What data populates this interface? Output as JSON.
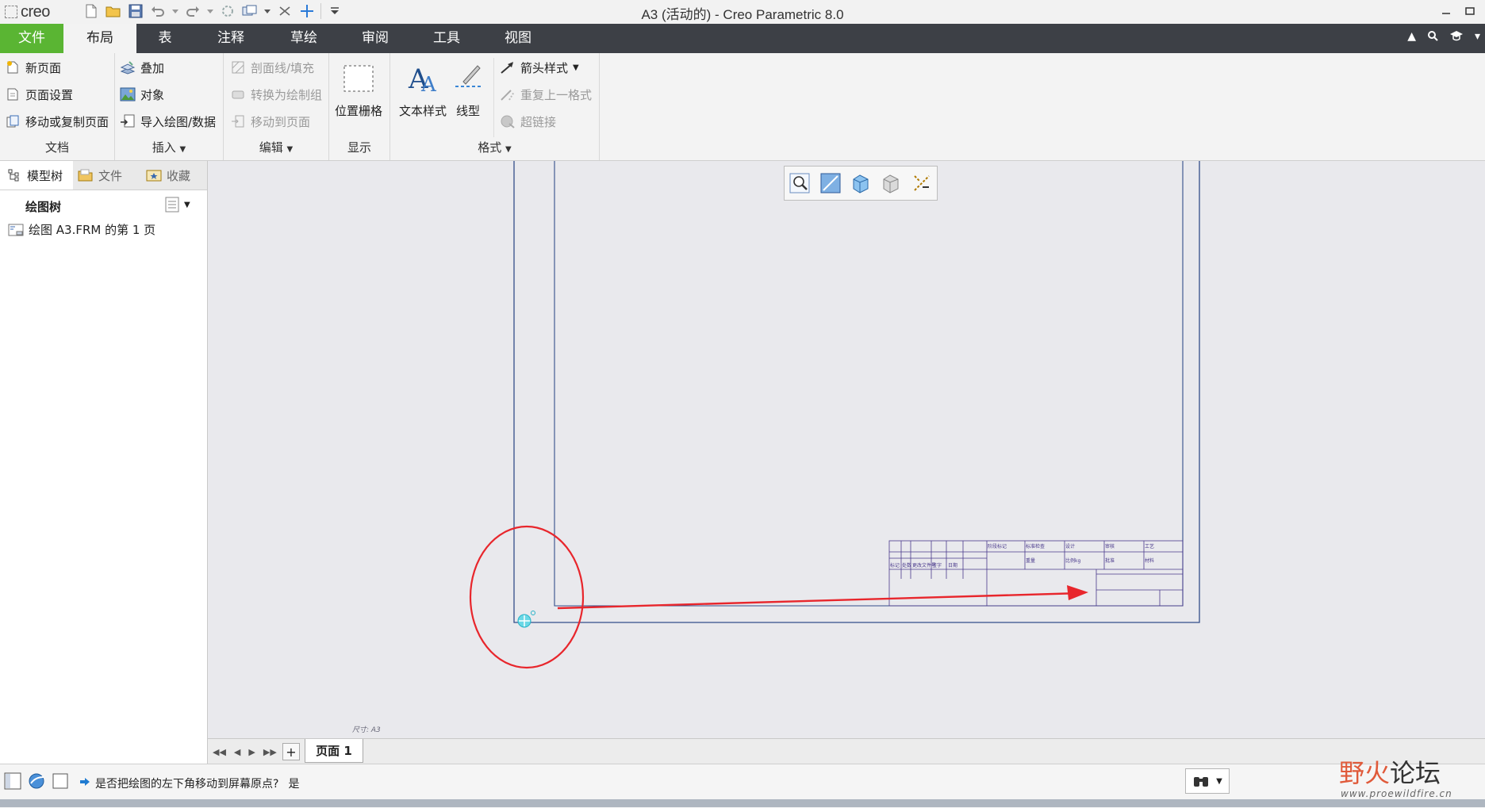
{
  "app": {
    "logo": "creo",
    "window_title": "A3 (活动的) - Creo Parametric 8.0"
  },
  "quick_access": [
    "new-icon",
    "open-icon",
    "save-icon",
    "undo-icon",
    "redo-icon",
    "regenerate-icon",
    "windows-icon",
    "close-window-icon",
    "datum-icon",
    "customize-icon"
  ],
  "tabs": {
    "file": "文件",
    "items": [
      "布局",
      "表",
      "注释",
      "草绘",
      "审阅",
      "工具",
      "视图"
    ],
    "active": "布局"
  },
  "ribbon": {
    "document": {
      "label": "文档",
      "new_page": "新页面",
      "page_setup": "页面设置",
      "move_copy_page": "移动或复制页面"
    },
    "insert": {
      "label": "插入",
      "overlay": "叠加",
      "object": "对象",
      "import_drawing": "导入绘图/数据"
    },
    "edit": {
      "label": "编辑",
      "hatch_fill": "剖面线/填充",
      "convert_group": "转换为绘制组",
      "move_to_page": "移动到页面"
    },
    "display": {
      "label": "显示",
      "location_grid": "位置栅格"
    },
    "format": {
      "label": "格式",
      "text_style": "文本样式",
      "line_style": "线型",
      "arrow_style": "箭头样式",
      "repeat_format": "重复上一格式",
      "hyperlink": "超链接"
    }
  },
  "left_panel": {
    "tabs": [
      "模型树",
      "文件",
      "收藏"
    ],
    "tree_title": "绘图树",
    "tree_items": [
      "绘图 A3.FRM 的第 1 页"
    ]
  },
  "drawing": {
    "sheet_name": "A3",
    "size_label": "尺寸: A3",
    "annotation_color": "#e8262c",
    "title_block": {
      "labels": [
        "标记",
        "处数",
        "更改文件号",
        "签字",
        "日期",
        "阶段标记",
        "标准检查",
        "重量",
        "比例",
        "设计",
        "审核",
        "工艺",
        "批准",
        "材料",
        "日期",
        "kg"
      ]
    }
  },
  "page_tabs": {
    "current": "页面 1"
  },
  "status": {
    "message": "是否把绘图的左下角移动到屏幕原点?",
    "answer": "是"
  },
  "watermark": {
    "title_a": "野火",
    "title_b": "论坛",
    "url": "www.proewildfire.cn"
  }
}
